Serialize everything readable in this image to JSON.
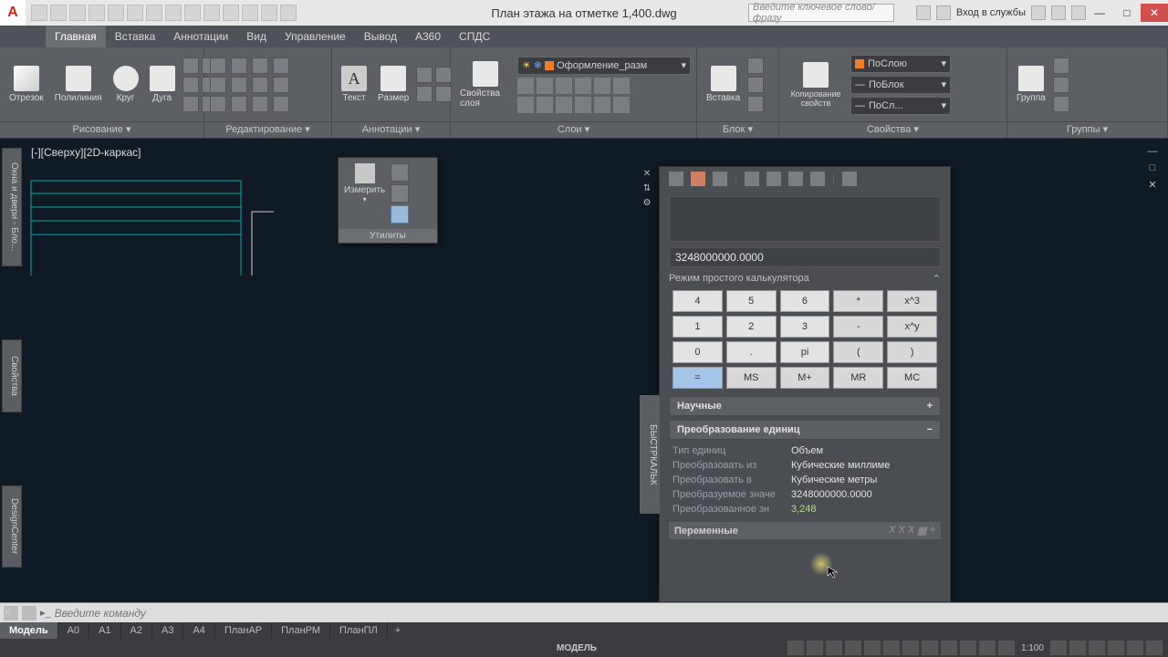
{
  "title": "План этажа на отметке 1,400.dwg",
  "search_placeholder": "Введите ключевое слово/фразу",
  "signin": "Вход в службы",
  "menu": [
    "Главная",
    "Вставка",
    "Аннотации",
    "Вид",
    "Управление",
    "Вывод",
    "A360",
    "СПДС"
  ],
  "menu_active": 0,
  "ribbon": {
    "draw": {
      "label": "Рисование ▾",
      "items": [
        "Отрезок",
        "Полилиния",
        "Круг",
        "Дуга"
      ]
    },
    "edit": {
      "label": "Редактирование ▾"
    },
    "ann": {
      "label": "Аннотации ▾",
      "items": [
        "Текст",
        "Размер"
      ]
    },
    "layers": {
      "label": "Слои ▾",
      "btn": "Свойства слоя",
      "current": "Оформление_разм",
      "swatch": "#ef7e2a"
    },
    "block": {
      "label": "Блок ▾",
      "btn": "Вставка"
    },
    "props": {
      "label": "Свойства ▾",
      "btn": "Копирование свойств",
      "bylayer": "ПоСлою",
      "byblock": "ПоБлок",
      "bylayer2": "ПоСл..."
    },
    "group": {
      "label": "Группы ▾",
      "btn": "Группа"
    }
  },
  "util_popup": {
    "measure": "Измерить",
    "label": "Утилиты"
  },
  "viewport": "[-][Сверху][2D-каркас]",
  "side_palettes": [
    "Окна и двери - Бло...",
    "Свойства",
    "DesignCenter"
  ],
  "calc": {
    "title": "БЫСТРКАЛЬК",
    "result": "3248000000.0000",
    "mode": "Режим простого калькулятора",
    "keys": [
      [
        "4",
        "5",
        "6",
        "*",
        "x^3"
      ],
      [
        "1",
        "2",
        "3",
        "-",
        "x^y"
      ],
      [
        "0",
        ".",
        "pi",
        "(",
        ")"
      ],
      [
        "=",
        "MS",
        "M+",
        "MR",
        "MC"
      ]
    ],
    "sect_sci": "Научные",
    "sect_conv": "Преобразование единиц",
    "conv": {
      "r0l": "Тип единиц",
      "r0v": "Объем",
      "r1l": "Преобразовать из",
      "r1v": "Кубические миллиме",
      "r2l": "Преобразовать в",
      "r2v": "Кубические метры",
      "r3l": "Преобразуемое значе",
      "r3v": "3248000000.0000",
      "r4l": "Преобразованное зн",
      "r4v": "3,248"
    },
    "sect_var": "Переменные"
  },
  "cmd_placeholder": "Введите команду",
  "tabs": [
    "Модель",
    "А0",
    "А1",
    "А2",
    "А3",
    "А4",
    "ПланАР",
    "ПланРМ",
    "ПланПЛ"
  ],
  "status_model": "МОДЕЛЬ",
  "status_scale": "1:100"
}
